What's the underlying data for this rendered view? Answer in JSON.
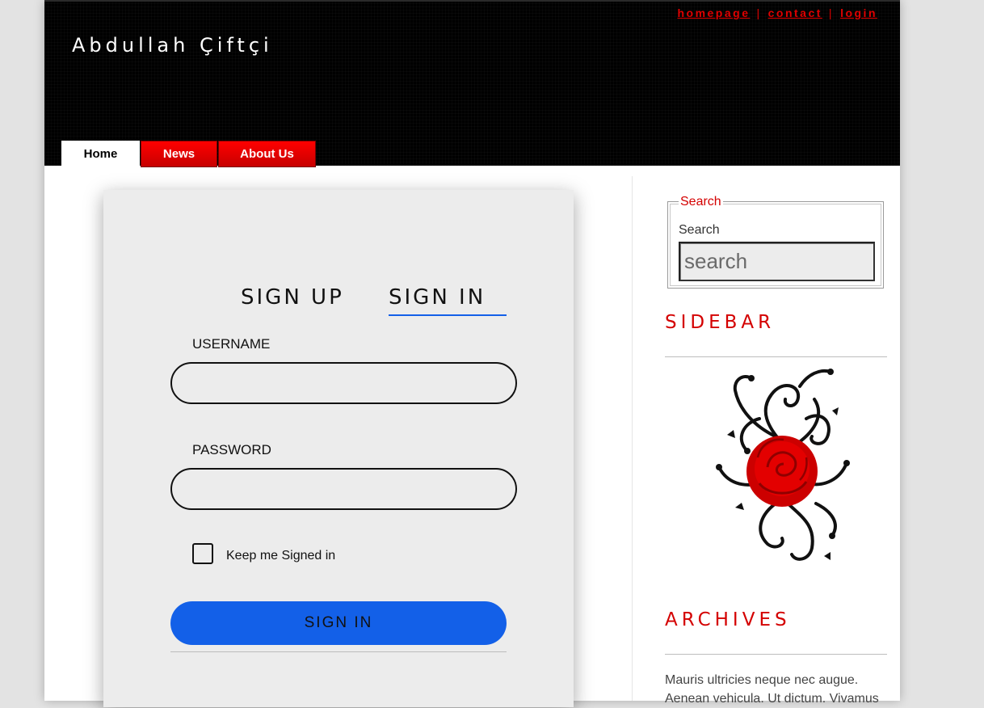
{
  "site": {
    "title": "Abdullah Çiftçi"
  },
  "topnav": {
    "items": [
      "homepage",
      "contact",
      "login"
    ],
    "separator": "|"
  },
  "tabs": [
    {
      "label": "Home",
      "active": true
    },
    {
      "label": "News",
      "active": false
    },
    {
      "label": "About Us",
      "active": false
    }
  ],
  "login_form": {
    "tabs": [
      "SIGN UP",
      "SIGN IN"
    ],
    "active_tab": "SIGN IN",
    "username_label": "USERNAME",
    "username_value": "",
    "password_label": "PASSWORD",
    "password_value": "",
    "remember_label": "Keep me Signed in",
    "remember_checked": false,
    "submit_label": "SIGN IN"
  },
  "search": {
    "legend": "Search",
    "label": "Search",
    "placeholder": "search",
    "value": ""
  },
  "sidebar": {
    "heading": "SIDEBAR",
    "image_icon": "rose-ornament-icon",
    "archives_heading": "ARCHIVES",
    "archives_lines": [
      "Mauris ultricies neque nec augue.",
      "Aenean vehicula. Ut dictum. Vivamus"
    ]
  },
  "colors": {
    "accent_red": "#d40000",
    "tab_red": "#e00000",
    "button_blue": "#1360e8",
    "header_bg": "#000000"
  }
}
